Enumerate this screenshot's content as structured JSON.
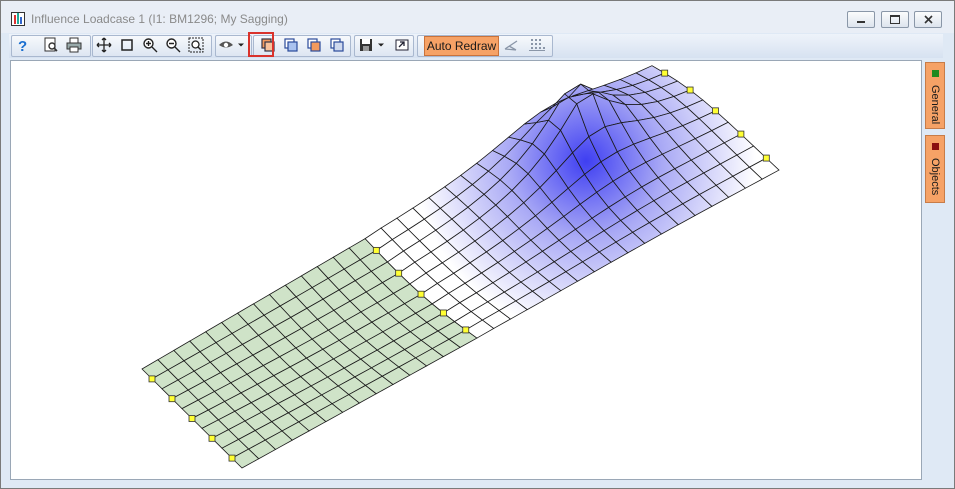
{
  "window": {
    "title": "Influence Loadcase 1 (I1: BM1296; My Sagging)",
    "controls": {
      "minimize": "minimize",
      "maximize": "maximize",
      "close": "close"
    }
  },
  "toolbar": {
    "auto_redraw_label": "Auto Redraw",
    "buttons": [
      "help-icon",
      "print-preview-icon",
      "print-icon",
      "pan-icon",
      "select-rectangle-icon",
      "zoom-in-icon",
      "zoom-out-icon",
      "zoom-extents-icon",
      "view-eye-icon",
      "chevron-down-icon",
      "display-mode-1-icon",
      "display-mode-2-icon",
      "display-mode-3-icon",
      "display-mode-4-icon",
      "save-icon",
      "chevron-down-icon",
      "copy-view-icon",
      "lasso-icon",
      "grid-icon"
    ],
    "active_button": "display-mode-1-icon"
  },
  "sidebar": {
    "tabs": [
      {
        "label": "General",
        "color": "#1f8a1f"
      },
      {
        "label": "Objects",
        "color": "#8a1010"
      }
    ]
  },
  "colors": {
    "accent": "#f6a266",
    "highlight_outline": "#d9322b",
    "green_mesh": "#cfe3c8",
    "blue_peak": "#3f3ff2",
    "node": "#ffff33"
  }
}
